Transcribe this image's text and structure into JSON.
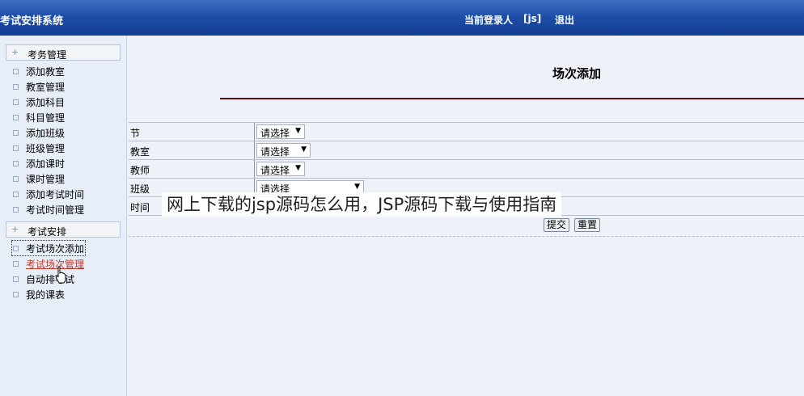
{
  "header": {
    "title": "考试安排系统",
    "current_user_label": "当前登录人",
    "current_user_value": "[js]",
    "logout_label": "退出"
  },
  "sidebar": {
    "groups": [
      {
        "label": "考务管理",
        "items": [
          "添加教室",
          "教室管理",
          "添加科目",
          "科目管理",
          "添加班级",
          "班级管理",
          "添加课时",
          "课时管理",
          "添加考试时间",
          "考试时间管理"
        ]
      },
      {
        "label": "考试安排",
        "items": [
          "考试场次添加",
          "考试场次管理",
          "自动排考试",
          "我的课表"
        ]
      }
    ],
    "icons": {
      "group_expand": "plus-icon",
      "item": "square-bullet-icon"
    }
  },
  "main": {
    "page_title": "场次添加",
    "form": {
      "rows": [
        {
          "label": "节",
          "select_value": "请选择"
        },
        {
          "label": "教室",
          "select_value": "请选择"
        },
        {
          "label": "教师",
          "select_value": "请选择"
        },
        {
          "label": "班级",
          "select_value": "请选择"
        },
        {
          "label": "时间",
          "select_value": ""
        }
      ],
      "submit_label": "提交",
      "reset_label": "重置"
    }
  },
  "overlay": {
    "caption": "网上下载的jsp源码怎么用，JSP源码下载与使用指南"
  },
  "colors": {
    "header_bg": "#1e4fa8",
    "sidebar_bg": "#e7eef8",
    "main_bg": "#eef2f8",
    "title_rule": "#5a0f12",
    "active_item_text": "#c0392b"
  }
}
